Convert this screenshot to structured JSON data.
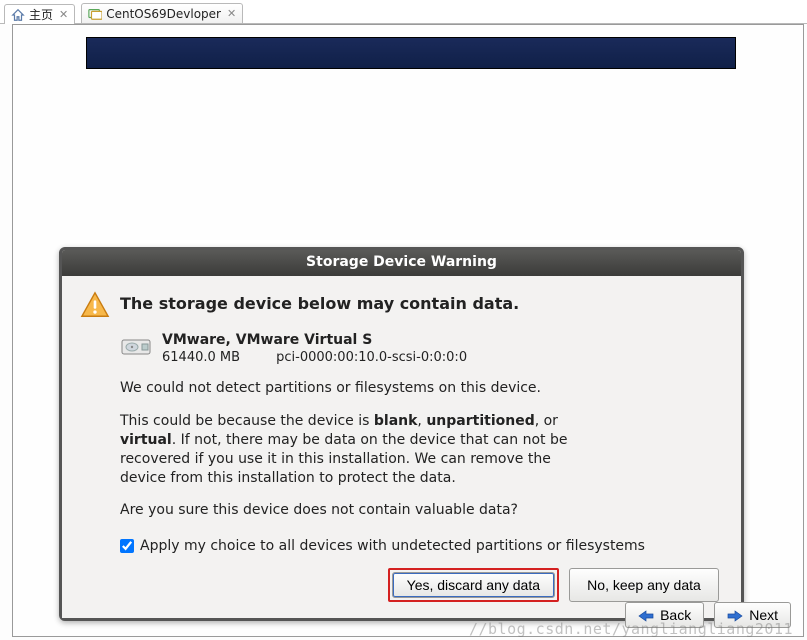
{
  "tabs": [
    {
      "label": "主页"
    },
    {
      "label": "CentOS69Devloper"
    }
  ],
  "dialog": {
    "title": "Storage Device Warning",
    "heading": "The storage device below may contain data.",
    "device": {
      "name": "VMware, VMware Virtual S",
      "size": "61440.0 MB",
      "path": "pci-0000:00:10.0-scsi-0:0:0:0"
    },
    "p1": "We could not detect partitions or filesystems on this device.",
    "p2_a": "This could be because the device is ",
    "p2_b_blank": "blank",
    "p2_c": ", ",
    "p2_d_unpart": "unpartitioned",
    "p2_e": ", or ",
    "p2_f_virtual": "virtual",
    "p2_g": ". If not, there may be data on the device that can not be recovered if you use it in this installation. We can remove the device from this installation to protect the data.",
    "p3": "Are you sure this device does not contain valuable data?",
    "checkbox_label": "Apply my choice to all devices with undetected partitions or filesystems",
    "checkbox_checked": true,
    "btn_discard": "Yes, discard any data",
    "btn_keep": "No, keep any data"
  },
  "nav": {
    "back": "Back",
    "next": "Next"
  },
  "watermark": "//blog.csdn.net/yangliangliang2011"
}
